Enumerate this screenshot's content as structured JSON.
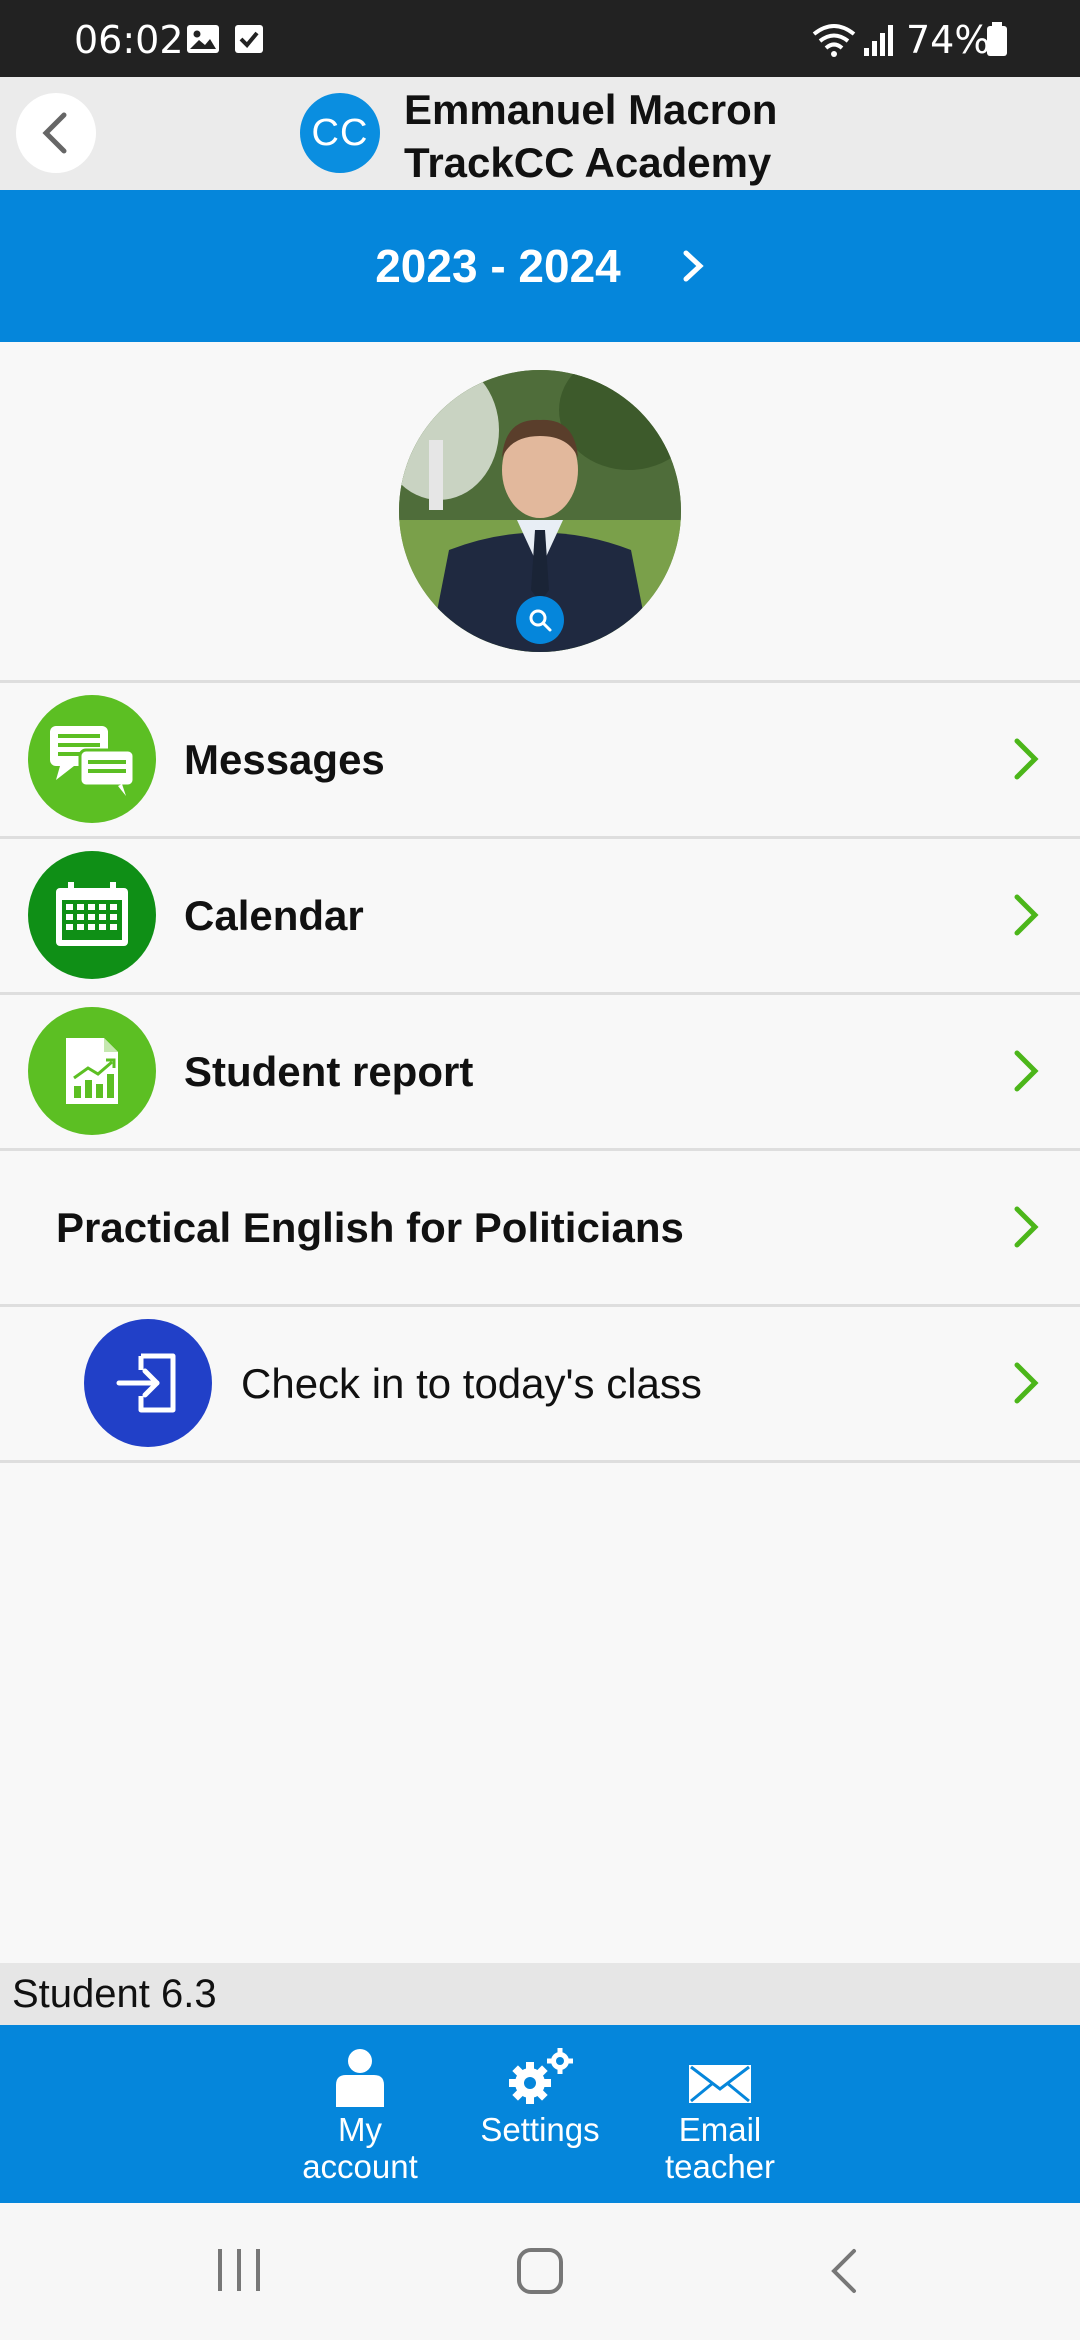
{
  "status_bar": {
    "time": "06:02",
    "battery": "74%",
    "icons": [
      "image-icon",
      "checkbox-icon",
      "wifi-icon",
      "signal-icon",
      "battery-icon"
    ]
  },
  "header": {
    "logo_text": "CC",
    "title_line1": "Emmanuel Macron",
    "title_line2": "TrackCC Academy"
  },
  "year": {
    "label": "2023 - 2024"
  },
  "menu": {
    "messages": "Messages",
    "calendar": "Calendar",
    "student_report": "Student report",
    "course": "Practical English for Politicians",
    "checkin": "Check in to today's class"
  },
  "footer": {
    "version": "Student 6.3"
  },
  "bottom_nav": {
    "my_account": [
      "My",
      "account"
    ],
    "settings": "Settings",
    "email_teacher": [
      "Email",
      "teacher"
    ]
  },
  "colors": {
    "primary_blue": "#0586db",
    "green_light": "#5cbf23",
    "green_dark": "#0f8f16",
    "checkin_blue": "#2140c8",
    "chevron_green": "#4cb61a"
  }
}
